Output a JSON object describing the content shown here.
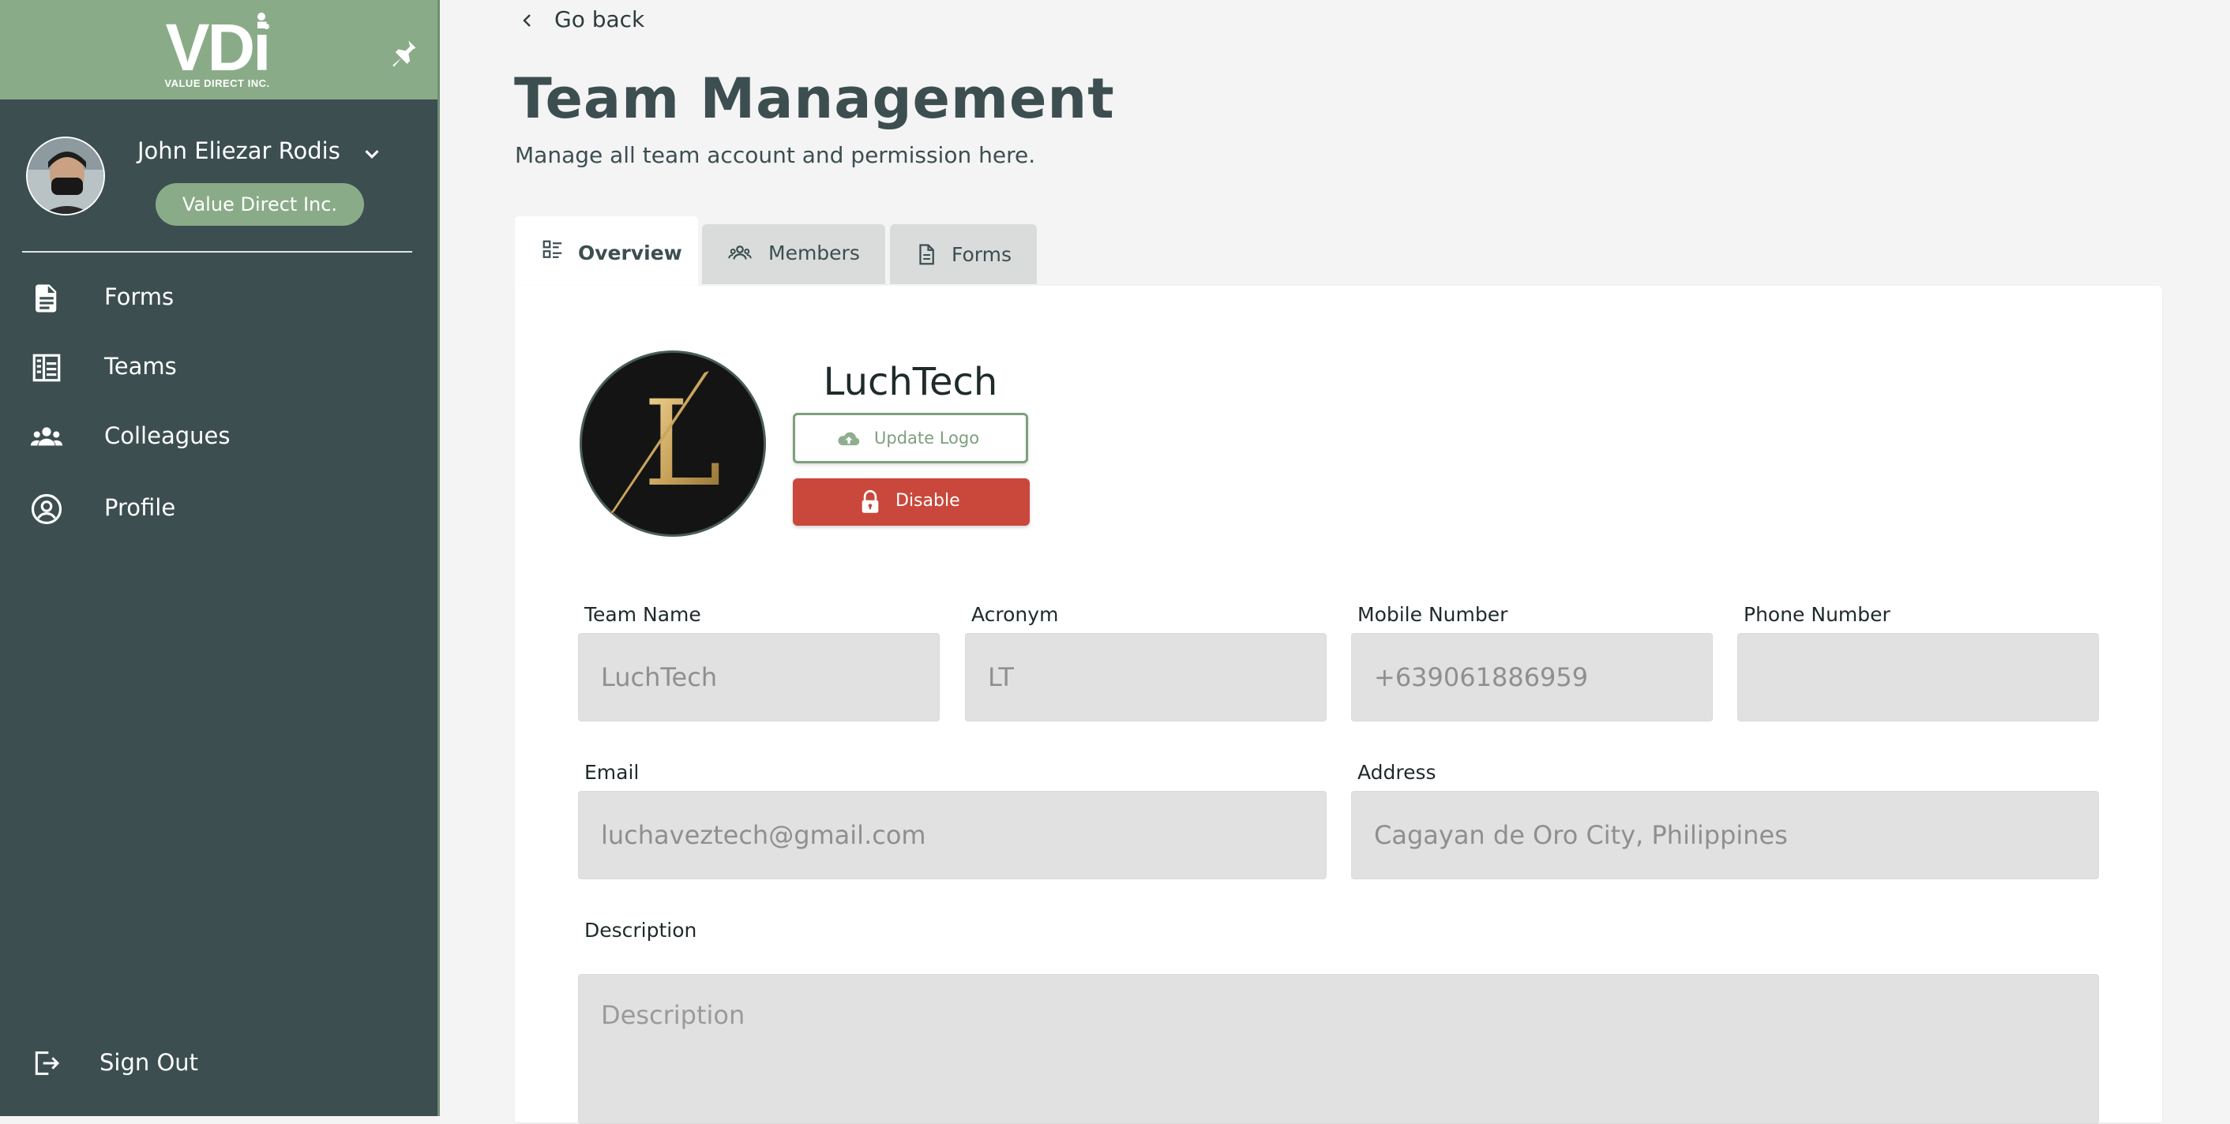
{
  "brand": {
    "logo_text": "VDi",
    "logo_sub": "VALUE DIRECT INC."
  },
  "user": {
    "name": "John Eliezar Rodis",
    "org": "Value Direct Inc."
  },
  "nav": [
    {
      "label": "Forms",
      "icon": "document-icon"
    },
    {
      "label": "Teams",
      "icon": "teams-icon"
    },
    {
      "label": "Colleagues",
      "icon": "people-icon"
    },
    {
      "label": "Profile",
      "icon": "profile-icon"
    }
  ],
  "signout": {
    "label": "Sign Out"
  },
  "header": {
    "go_back": "Go back",
    "title": "Team Management",
    "subtitle": "Manage all team account and permission here."
  },
  "tabs": [
    {
      "label": "Overview",
      "active": true
    },
    {
      "label": "Members",
      "active": false
    },
    {
      "label": "Forms",
      "active": false
    }
  ],
  "team": {
    "name": "LuchTech",
    "update_logo": "Update Logo",
    "disable": "Disable"
  },
  "fields": {
    "team_name": {
      "label": "Team Name",
      "value": "LuchTech"
    },
    "acronym": {
      "label": "Acronym",
      "value": "LT"
    },
    "mobile": {
      "label": "Mobile Number",
      "value": "+639061886959"
    },
    "phone": {
      "label": "Phone Number",
      "value": ""
    },
    "email": {
      "label": "Email",
      "value": "luchaveztech@gmail.com"
    },
    "address": {
      "label": "Address",
      "value": "Cagayan de Oro City, Philippines"
    },
    "description": {
      "label": "Description",
      "placeholder": "Description",
      "value": ""
    }
  },
  "colors": {
    "sidebar": "#3c4e50",
    "accent_green": "#8aab88",
    "danger": "#c9483b"
  }
}
